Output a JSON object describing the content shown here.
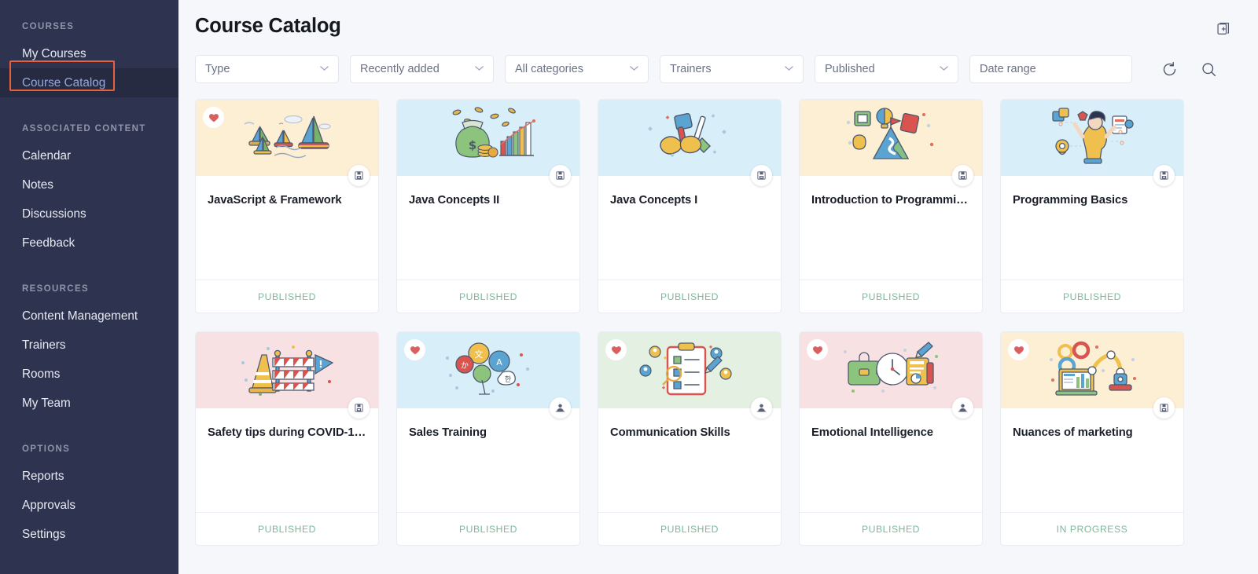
{
  "sidebar": {
    "groups": [
      {
        "title": "COURSES",
        "items": [
          {
            "label": "My Courses",
            "active": false
          },
          {
            "label": "Course Catalog",
            "active": true
          }
        ]
      },
      {
        "title": "ASSOCIATED CONTENT",
        "items": [
          {
            "label": "Calendar",
            "active": false
          },
          {
            "label": "Notes",
            "active": false
          },
          {
            "label": "Discussions",
            "active": false
          },
          {
            "label": "Feedback",
            "active": false
          }
        ]
      },
      {
        "title": "RESOURCES",
        "items": [
          {
            "label": "Content Management",
            "active": false
          },
          {
            "label": "Trainers",
            "active": false
          },
          {
            "label": "Rooms",
            "active": false
          },
          {
            "label": "My Team",
            "active": false
          }
        ]
      },
      {
        "title": "OPTIONS",
        "items": [
          {
            "label": "Reports",
            "active": false
          },
          {
            "label": "Approvals",
            "active": false
          },
          {
            "label": "Settings",
            "active": false
          }
        ]
      }
    ]
  },
  "header": {
    "title": "Course Catalog",
    "add_icon": "add-copy-icon"
  },
  "filters": [
    {
      "name": "type",
      "value": "Type",
      "kind": "select"
    },
    {
      "name": "sort",
      "value": "Recently added",
      "kind": "select"
    },
    {
      "name": "categories",
      "value": "All categories",
      "kind": "select"
    },
    {
      "name": "trainers",
      "value": "Trainers",
      "kind": "select"
    },
    {
      "name": "published",
      "value": "Published",
      "kind": "select"
    },
    {
      "name": "date-range",
      "value": "Date range",
      "kind": "text"
    }
  ],
  "filter_actions": [
    {
      "name": "reset-filters",
      "icon": "refresh-icon"
    },
    {
      "name": "search",
      "icon": "search-icon"
    }
  ],
  "colors": {
    "sidebar_bg": "#2e3450",
    "sidebar_active_bg": "#262b42",
    "sidebar_active_text": "#93a8e0",
    "annotation": "#e8603c",
    "status_published": "#7fb79a",
    "page_bg": "#f6f7fb",
    "hero_cream": "#fcefd4",
    "hero_blue": "#d8eef8",
    "hero_pink": "#f8e1e2",
    "hero_green": "#e4f0e1"
  },
  "cards": [
    {
      "title": "JavaScript & Framework",
      "status": "PUBLISHED",
      "favorite": true,
      "hero": "cream",
      "art": "sailboats",
      "badge": "elearning-icon"
    },
    {
      "title": "Java Concepts II",
      "status": "PUBLISHED",
      "favorite": false,
      "hero": "blue",
      "art": "moneybag",
      "badge": "elearning-icon"
    },
    {
      "title": "Java Concepts I",
      "status": "PUBLISHED",
      "favorite": false,
      "hero": "blue",
      "art": "tools",
      "badge": "elearning-icon"
    },
    {
      "title": "Introduction to Programmi…",
      "status": "PUBLISHED",
      "favorite": false,
      "hero": "cream",
      "art": "mountain",
      "badge": "elearning-icon"
    },
    {
      "title": "Programming Basics",
      "status": "PUBLISHED",
      "favorite": false,
      "hero": "blue",
      "art": "person-tasks",
      "badge": "elearning-icon"
    },
    {
      "title": "Safety tips during COVID-1…",
      "status": "PUBLISHED",
      "favorite": false,
      "hero": "pink",
      "art": "barrier",
      "badge": "elearning-icon"
    },
    {
      "title": "Sales Training",
      "status": "PUBLISHED",
      "favorite": true,
      "hero": "blue",
      "art": "speech-bubbles",
      "badge": "instructor-led-icon"
    },
    {
      "title": "Communication Skills",
      "status": "PUBLISHED",
      "favorite": true,
      "hero": "green",
      "art": "clipboard",
      "badge": "instructor-led-icon"
    },
    {
      "title": "Emotional Intelligence",
      "status": "PUBLISHED",
      "favorite": true,
      "hero": "pink",
      "art": "briefcase-clock",
      "badge": "instructor-led-icon"
    },
    {
      "title": "Nuances of marketing",
      "status": "IN PROGRESS",
      "favorite": true,
      "hero": "cream",
      "art": "robot-arm",
      "badge": "elearning-icon"
    }
  ]
}
